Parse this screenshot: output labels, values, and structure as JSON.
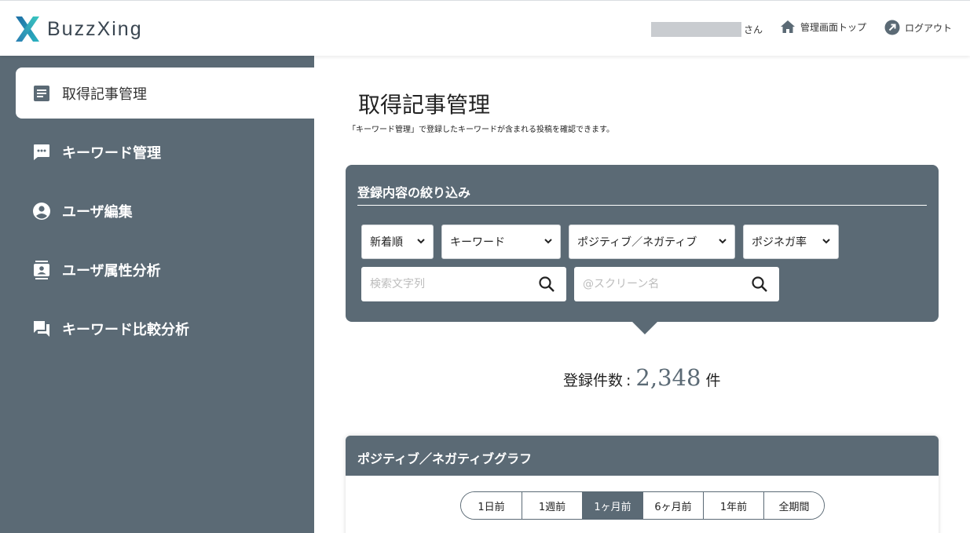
{
  "header": {
    "logo_text": "BuzzXing",
    "user_suffix": "さん",
    "admin_top_label": "管理画面トップ",
    "logout_label": "ログアウト"
  },
  "sidebar": {
    "items": [
      {
        "label": "取得記事管理",
        "icon": "article-icon",
        "active": true
      },
      {
        "label": "キーワード管理",
        "icon": "chat-bubble-icon",
        "active": false
      },
      {
        "label": "ユーザ編集",
        "icon": "account-circle-icon",
        "active": false
      },
      {
        "label": "ユーザ属性分析",
        "icon": "contact-card-icon",
        "active": false
      },
      {
        "label": "キーワード比較分析",
        "icon": "forum-icon",
        "active": false
      }
    ]
  },
  "main": {
    "title": "取得記事管理",
    "description": "「キーワード管理」で登録したキーワードが含まれる投稿を確認できます。"
  },
  "filter": {
    "title": "登録内容の絞り込み",
    "selects": {
      "sort": "新着順",
      "keyword": "キーワード",
      "sentiment": "ポジティブ／ネガティブ",
      "ratio": "ポジネガ率"
    },
    "search_text_placeholder": "検索文字列",
    "search_screen_placeholder": "@スクリーン名"
  },
  "count": {
    "label": "登録件数",
    "colon": ":",
    "value": "2,348",
    "unit": "件"
  },
  "graph": {
    "title": "ポジティブ／ネガティブグラフ",
    "periods": [
      "1日前",
      "1週前",
      "1ヶ月前",
      "6ヶ月前",
      "1年前",
      "全期間"
    ],
    "active_period": "1ヶ月前"
  },
  "colors": {
    "primary": "#5b6a75",
    "logo_teal": "#2bb3c0",
    "logo_blue": "#1f6fa6"
  }
}
